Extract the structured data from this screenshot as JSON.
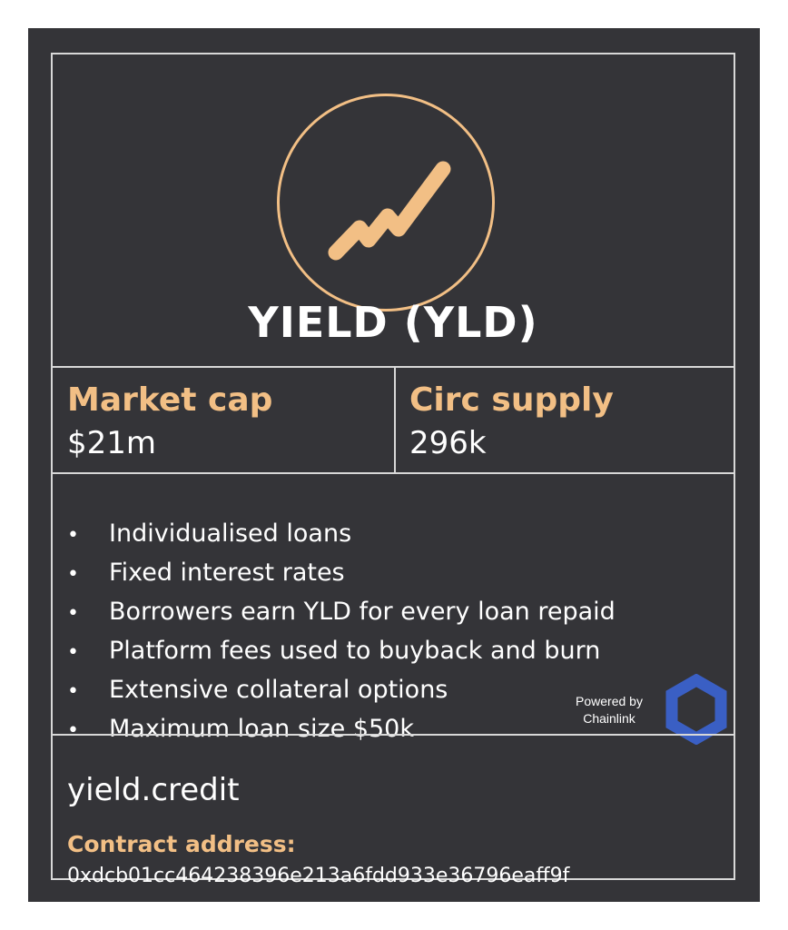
{
  "title": "YIELD (YLD)",
  "stats": {
    "market_cap_label": "Market cap",
    "market_cap_value": "$21m",
    "circ_supply_label": "Circ supply",
    "circ_supply_value": "296k"
  },
  "features": [
    "Individualised loans",
    "Fixed interest rates",
    "Borrowers earn YLD for every loan repaid",
    "Platform fees used to buyback and burn",
    "Extensive collateral options",
    "Maximum loan size $50k"
  ],
  "powered_by": {
    "line1": "Powered by",
    "line2": "Chainlink"
  },
  "website": "yield.credit",
  "contract": {
    "label": "Contract address:",
    "address": "0xdcb01cc464238396e213a6fdd933e36796eaff9f"
  },
  "colors": {
    "background": "#343438",
    "accent": "#f2bf85",
    "border": "#d8d8d8",
    "chainlink": "#3a5fc4"
  },
  "icons": {
    "logo": "trend-line-icon",
    "chainlink": "chainlink-hexagon-icon"
  }
}
